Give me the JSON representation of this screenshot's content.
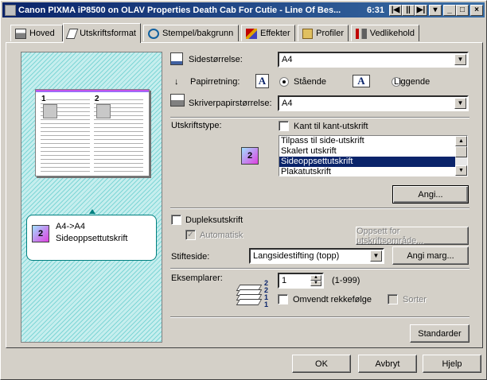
{
  "window": {
    "title": "Canon PIXMA iP8500 on OLAV Properties  Death Cab For Cutie - Line Of Bes...",
    "time": "6:31"
  },
  "tabs": [
    {
      "label": "Hoved"
    },
    {
      "label": "Utskriftsformat"
    },
    {
      "label": "Stempel/bakgrunn"
    },
    {
      "label": "Effekter"
    },
    {
      "label": "Profiler"
    },
    {
      "label": "Vedlikehold"
    }
  ],
  "preview": {
    "page_labels": [
      "1",
      "2"
    ],
    "summary_line1": "A4->A4",
    "summary_line2": "Sideoppsettutskrift",
    "icon_label": "2"
  },
  "page_size": {
    "label": "Sidestørrelse:",
    "value": "A4"
  },
  "orientation": {
    "label": "Papirretning:",
    "portrait": "Stående",
    "landscape": "Liggende",
    "icon_letter": "A"
  },
  "printer_paper": {
    "label": "Skriverpapirstørrelse:",
    "value": "A4"
  },
  "print_type": {
    "label": "Utskriftstype:",
    "borderless_label": "Kant til kant-utskrift",
    "icon_label": "2",
    "options": [
      "Tilpass til side-utskrift",
      "Skalert utskrift",
      "Sideoppsettutskrift",
      "Plakatutskrift"
    ],
    "selected_index": 2,
    "specify_button": "Angi..."
  },
  "duplex": {
    "label": "Dupleksutskrift",
    "auto_label": "Automatisk",
    "area_button": "Oppsett for utskriftsområde..."
  },
  "stapling": {
    "label": "Stifteside:",
    "value": "Langsidestifting (topp)",
    "margin_button": "Angi marg..."
  },
  "copies": {
    "label": "Eksemplarer:",
    "value": "1",
    "range": "(1-999)",
    "reverse_label": "Omvendt rekkefølge",
    "collate_label": "Sorter",
    "stack_digits": "2 2 1 1"
  },
  "buttons": {
    "defaults": "Standarder",
    "ok": "OK",
    "cancel": "Avbryt",
    "help": "Hjelp"
  }
}
